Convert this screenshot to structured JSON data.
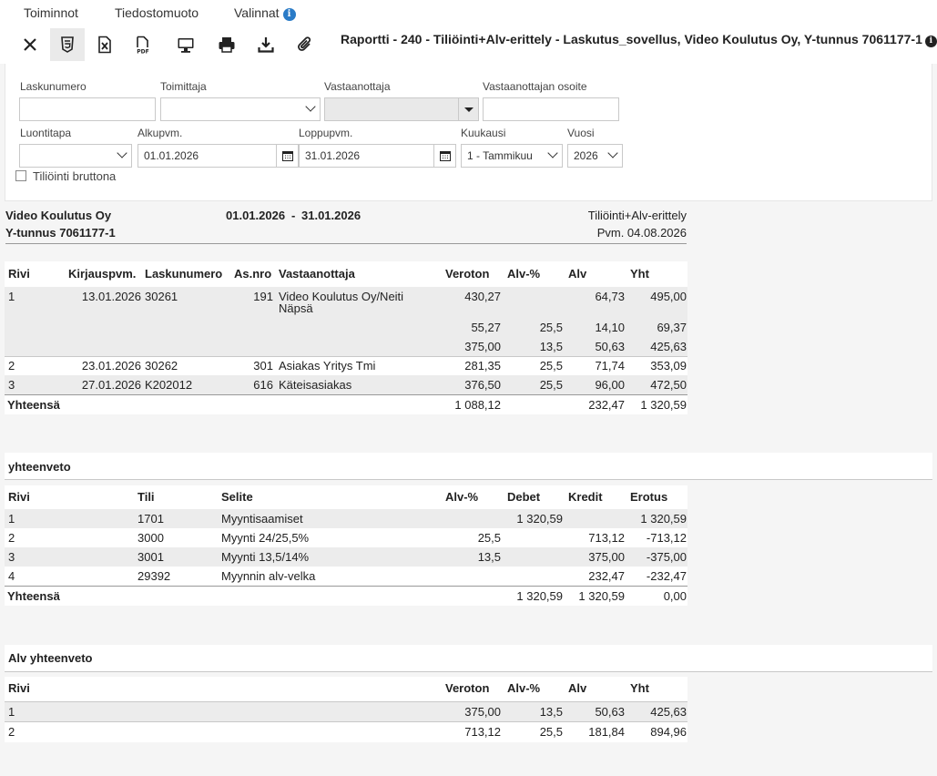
{
  "menu": {
    "toiminnot": "Toiminnot",
    "tiedostomuoto": "Tiedostomuoto",
    "valinnat": "Valinnat",
    "valinnat_icon": "info-icon"
  },
  "toolbar": {
    "icons": [
      "close-icon",
      "html5-icon",
      "excel-icon",
      "pdf-icon",
      "monitor-icon",
      "print-icon",
      "download-icon",
      "attachment-icon"
    ],
    "title": "Raportti - 240 - Tiliöinti+Alv-erittely - Laskutus_sovellus, Video Koulutus Oy, Y-tunnus 7061177-1"
  },
  "filters": {
    "laskunumero_label": "Laskunumero",
    "laskunumero_value": "",
    "toimittaja_label": "Toimittaja",
    "toimittaja_value": "",
    "vastaanottaja_label": "Vastaanottaja",
    "vastaanottaja_value": "",
    "vastaanottajan_osoite_label": "Vastaanottajan osoite",
    "vastaanottajan_osoite_value": "",
    "luontitapa_label": "Luontitapa",
    "luontitapa_value": "",
    "alkupvm_label": "Alkupvm.",
    "alkupvm_value": "01.01.2026",
    "loppupvm_label": "Loppupvm.",
    "loppupvm_value": "31.01.2026",
    "kuukausi_label": "Kuukausi",
    "kuukausi_value": "1 - Tammikuu",
    "vuosi_label": "Vuosi",
    "vuosi_value": "2026",
    "bruttona_label": "Tiliöinti bruttona"
  },
  "header": {
    "company": "Video Koulutus Oy",
    "ytunnus": "Y-tunnus 7061177-1",
    "period_start": "01.01.2026",
    "period_sep": "-",
    "period_end": "31.01.2026",
    "report_name": "Tiliöinti+Alv-erittely",
    "print_date": "Pvm. 04.08.2026"
  },
  "main_table": {
    "columns": [
      "Rivi",
      "Kirjauspvm.",
      "Laskunumero",
      "As.nro",
      "Vastaanottaja",
      "Veroton",
      "Alv-%",
      "Alv",
      "Yht"
    ],
    "rows": [
      {
        "rivi": "1",
        "kirjauspvm": "13.01.2026",
        "laskunumero": "30261",
        "asnro": "191",
        "vastaanottaja_1": "Video Koulutus Oy/Neiti",
        "vastaanottaja_2": "Näpsä",
        "veroton": "430,27",
        "alvp": "",
        "alv": "64,73",
        "yht": "495,00"
      },
      {
        "rivi": "",
        "kirjauspvm": "",
        "laskunumero": "",
        "asnro": "",
        "vastaanottaja_1": "",
        "vastaanottaja_2": "",
        "veroton": "55,27",
        "alvp": "25,5",
        "alv": "14,10",
        "yht": "69,37"
      },
      {
        "rivi": "",
        "kirjauspvm": "",
        "laskunumero": "",
        "asnro": "",
        "vastaanottaja_1": "",
        "vastaanottaja_2": "",
        "veroton": "375,00",
        "alvp": "13,5",
        "alv": "50,63",
        "yht": "425,63"
      },
      {
        "rivi": "2",
        "kirjauspvm": "23.01.2026",
        "laskunumero": "30262",
        "asnro": "301",
        "vastaanottaja_1": "Asiakas Yritys Tmi",
        "vastaanottaja_2": "",
        "veroton": "281,35",
        "alvp": "25,5",
        "alv": "71,74",
        "yht": "353,09"
      },
      {
        "rivi": "3",
        "kirjauspvm": "27.01.2026",
        "laskunumero": "K202012",
        "asnro": "616",
        "vastaanottaja_1": "Käteisasiakas",
        "vastaanottaja_2": "",
        "veroton": "376,50",
        "alvp": "25,5",
        "alv": "96,00",
        "yht": "472,50"
      }
    ],
    "total_label": "Yhteensä",
    "total_veroton": "1 088,12",
    "total_alv": "232,47",
    "total_yht": "1 320,59"
  },
  "yhteenveto": {
    "title": "yhteenveto",
    "columns": [
      "Rivi",
      "Tili",
      "Selite",
      "Alv-%",
      "Debet",
      "Kredit",
      "Erotus"
    ],
    "rows": [
      {
        "rivi": "1",
        "tili": "1701",
        "selite": "Myyntisaamiset",
        "alvp": "",
        "debet": "1 320,59",
        "kredit": "",
        "erotus": "1 320,59"
      },
      {
        "rivi": "2",
        "tili": "3000",
        "selite": "Myynti 24/25,5%",
        "alvp": "25,5",
        "debet": "",
        "kredit": "713,12",
        "erotus": "-713,12"
      },
      {
        "rivi": "3",
        "tili": "3001",
        "selite": "Myynti 13,5/14%",
        "alvp": "13,5",
        "debet": "",
        "kredit": "375,00",
        "erotus": "-375,00"
      },
      {
        "rivi": "4",
        "tili": "29392",
        "selite": "Myynnin alv-velka",
        "alvp": "",
        "debet": "",
        "kredit": "232,47",
        "erotus": "-232,47"
      }
    ],
    "total_label": "Yhteensä",
    "total_debet": "1 320,59",
    "total_kredit": "1 320,59",
    "total_erotus": "0,00"
  },
  "alv_yhteenveto": {
    "title": "Alv yhteenveto",
    "columns": [
      "Rivi",
      "Veroton",
      "Alv-%",
      "Alv",
      "Yht"
    ],
    "rows": [
      {
        "rivi": "1",
        "veroton": "375,00",
        "alvp": "13,5",
        "alv": "50,63",
        "yht": "425,63"
      },
      {
        "rivi": "2",
        "veroton": "713,12",
        "alvp": "25,5",
        "alv": "181,84",
        "yht": "894,96"
      }
    ]
  }
}
